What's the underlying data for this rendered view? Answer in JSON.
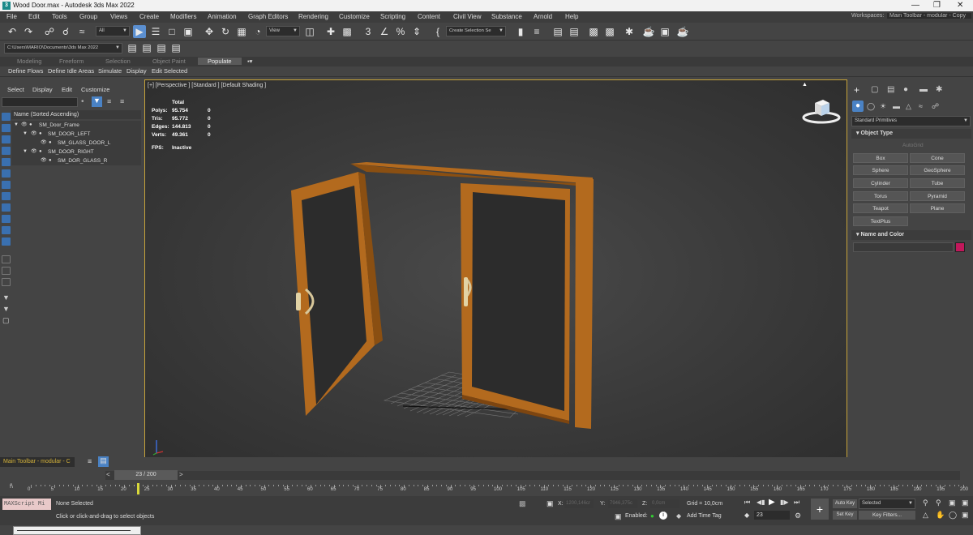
{
  "window": {
    "title": "Wood Door.max - Autodesk 3ds Max 2022"
  },
  "menu": [
    "File",
    "Edit",
    "Tools",
    "Group",
    "Views",
    "Create",
    "Modifiers",
    "Animation",
    "Graph Editors",
    "Rendering",
    "Customize",
    "Scripting",
    "Content",
    "Civil View",
    "Substance",
    "Arnold",
    "Help"
  ],
  "workspaces": {
    "label": "Workspaces:",
    "value": "Main Toolbar - modular - Copy"
  },
  "toolbar": {
    "filter_value": "All",
    "view_value": "View",
    "selection_set": "Create Selection Se"
  },
  "path_field": "C:\\Users\\MARIO\\Documents\\3ds Max 2022",
  "ribbon": {
    "tabs": [
      "Modeling",
      "Freeform",
      "Selection",
      "Object Paint",
      "Populate"
    ],
    "active_tab": "Populate",
    "subtabs": [
      "Define Flows",
      "Define Idle Areas",
      "Simulate",
      "Display",
      "Edit Selected"
    ]
  },
  "scene_explorer": {
    "menu": [
      "Select",
      "Display",
      "Edit",
      "Customize"
    ],
    "header": "Name (Sorted Ascending)",
    "items": [
      {
        "label": "SM_Door_Frame"
      },
      {
        "label": "SM_DOOR_LEFT"
      },
      {
        "label": "SM_GLASS_DOOR_L"
      },
      {
        "label": "SM_DOOR_RIGHT"
      },
      {
        "label": "SM_DOR_GLASS_R"
      }
    ]
  },
  "viewport": {
    "label": "[+] [Perspective ] [Standard ] [Default Shading ]",
    "stats": {
      "total_label": "Total",
      "rows": [
        {
          "label": "Polys:",
          "value": "95.754",
          "sel": "0"
        },
        {
          "label": "Tris:",
          "value": "95.772",
          "sel": "0"
        },
        {
          "label": "Edges:",
          "value": "144.813",
          "sel": "0"
        },
        {
          "label": "Verts:",
          "value": "49.361",
          "sel": "0"
        }
      ],
      "fps_label": "FPS:",
      "fps_value": "Inactive"
    }
  },
  "command_panel": {
    "category": "Standard Primitives",
    "object_type_header": "Object Type",
    "autogrid": "AutoGrid",
    "buttons": [
      "Box",
      "Cone",
      "Sphere",
      "GeoSphere",
      "Cylinder",
      "Tube",
      "Torus",
      "Pyramid",
      "Teapot",
      "Plane",
      "TextPlus"
    ],
    "name_color_header": "Name and Color",
    "swatch_color": "#c2185b"
  },
  "bottom": {
    "toolbar_label": "Main Toolbar - modular - C",
    "time_slider": "23 / 200",
    "ruler_ticks": [
      0,
      5,
      10,
      15,
      20,
      25,
      30,
      35,
      40,
      45,
      50,
      55,
      60,
      65,
      70,
      75,
      80,
      85,
      90,
      95,
      100,
      105,
      110,
      115,
      120,
      125,
      130,
      135,
      140,
      145,
      150,
      155,
      160,
      165,
      170,
      175,
      180,
      185,
      190,
      195,
      200
    ],
    "maxscript": "MAXScript Mi",
    "status_top": "None Selected",
    "status_bottom": "Click or click-and-drag to select objects",
    "x_label": "X:",
    "x_value": "1200,146cr",
    "y_label": "Y:",
    "y_value": "7946,375c",
    "z_label": "Z:",
    "z_value": "0,0cm",
    "grid": "Grid = 10,0cm",
    "enabled": "Enabled:",
    "add_time_tag": "Add Time Tag",
    "frame": "23",
    "auto_key": "Auto Key",
    "set_key": "Set Key",
    "selected": "Selected",
    "key_filters": "Key Filters..."
  }
}
